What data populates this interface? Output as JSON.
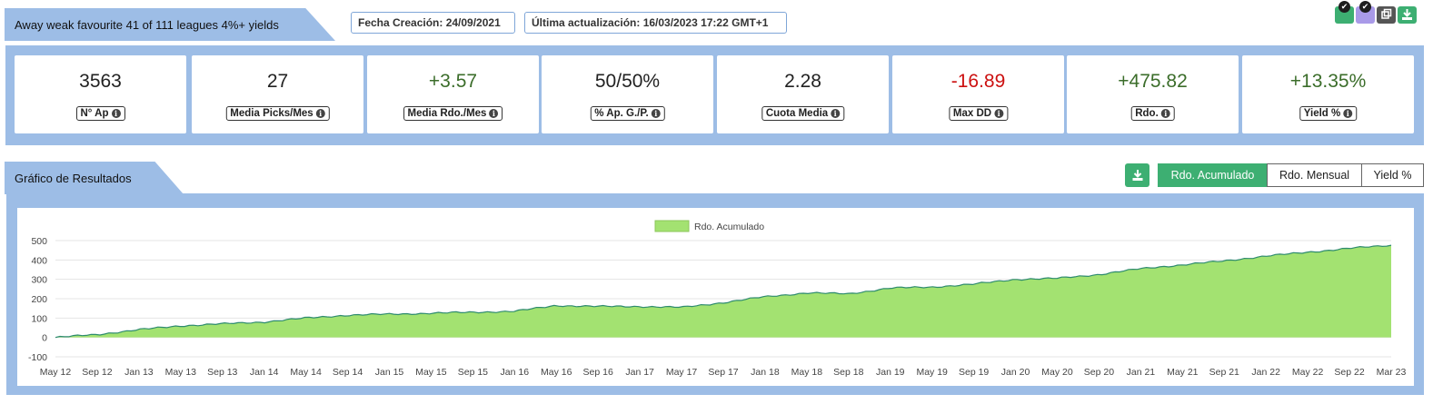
{
  "header": {
    "strategy_title": "Away weak favourite 41 of 111 leagues 4%+ yields",
    "created": "Fecha Creación: 24/09/2021",
    "updated": "Última actualización: 16/03/2023 17:22 GMT+1"
  },
  "corner_icons": [
    {
      "name": "check-icon",
      "color": "#3daf72"
    },
    {
      "name": "check-icon",
      "color": "#a99ae8"
    },
    {
      "name": "copy-icon",
      "color": "#555555"
    },
    {
      "name": "download-icon",
      "color": "#3daf72"
    }
  ],
  "stats": [
    {
      "value": "3563",
      "label": "N° Ap",
      "tone": "neutral"
    },
    {
      "value": "27",
      "label": "Media Picks/Mes",
      "tone": "neutral"
    },
    {
      "value": "+3.57",
      "label": "Media Rdo./Mes",
      "tone": "pos"
    },
    {
      "value": "50/50%",
      "label": "% Ap. G./P.",
      "tone": "neutral"
    },
    {
      "value": "2.28",
      "label": "Cuota Media",
      "tone": "neutral"
    },
    {
      "value": "-16.89",
      "label": "Max DD",
      "tone": "neg"
    },
    {
      "value": "+475.82",
      "label": "Rdo.",
      "tone": "pos"
    },
    {
      "value": "+13.35%",
      "label": "Yield %",
      "tone": "pos"
    }
  ],
  "chart_section": {
    "title": "Gráfico de Resultados",
    "buttons": [
      {
        "label": "Rdo. Acumulado",
        "active": true
      },
      {
        "label": "Rdo. Mensual",
        "active": false
      },
      {
        "label": "Yield %",
        "active": false
      }
    ]
  },
  "colors": {
    "panel": "#9dbde6",
    "accent": "#3daf72",
    "area_fill": "#a3e271",
    "area_line": "#2e8b6e"
  },
  "chart_data": {
    "type": "area",
    "legend": "Rdo. Acumulado",
    "legend_position": "top-center",
    "grid": true,
    "ylim": [
      -100,
      500
    ],
    "yticks": [
      500,
      400,
      300,
      200,
      100,
      0,
      -100
    ],
    "x_tick_labels": [
      "May 12",
      "Sep 12",
      "Jan 13",
      "May 13",
      "Sep 13",
      "Jan 14",
      "May 14",
      "Sep 14",
      "Jan 15",
      "May 15",
      "Sep 15",
      "Jan 16",
      "May 16",
      "Sep 16",
      "Jan 17",
      "May 17",
      "Sep 17",
      "Jan 18",
      "May 18",
      "Sep 18",
      "Jan 19",
      "May 19",
      "Sep 19",
      "Jan 20",
      "May 20",
      "Sep 20",
      "Jan 21",
      "May 21",
      "Sep 21",
      "Jan 22",
      "May 22",
      "Sep 22",
      "Mar 23"
    ],
    "x": [
      "May 12",
      "Sep 12",
      "Jan 13",
      "May 13",
      "Sep 13",
      "Jan 14",
      "May 14",
      "Sep 14",
      "Jan 15",
      "May 15",
      "Sep 15",
      "Jan 16",
      "May 16",
      "Sep 16",
      "Jan 17",
      "May 17",
      "Sep 17",
      "Jan 18",
      "May 18",
      "Sep 18",
      "Jan 19",
      "May 19",
      "Sep 19",
      "Jan 20",
      "May 20",
      "Sep 20",
      "Jan 21",
      "May 21",
      "Sep 21",
      "Jan 22",
      "May 22",
      "Sep 22",
      "Mar 23"
    ],
    "values": [
      0,
      15,
      40,
      60,
      70,
      80,
      100,
      115,
      120,
      125,
      130,
      135,
      165,
      160,
      160,
      155,
      180,
      210,
      230,
      225,
      255,
      260,
      275,
      300,
      305,
      325,
      355,
      375,
      395,
      420,
      440,
      460,
      476
    ]
  }
}
